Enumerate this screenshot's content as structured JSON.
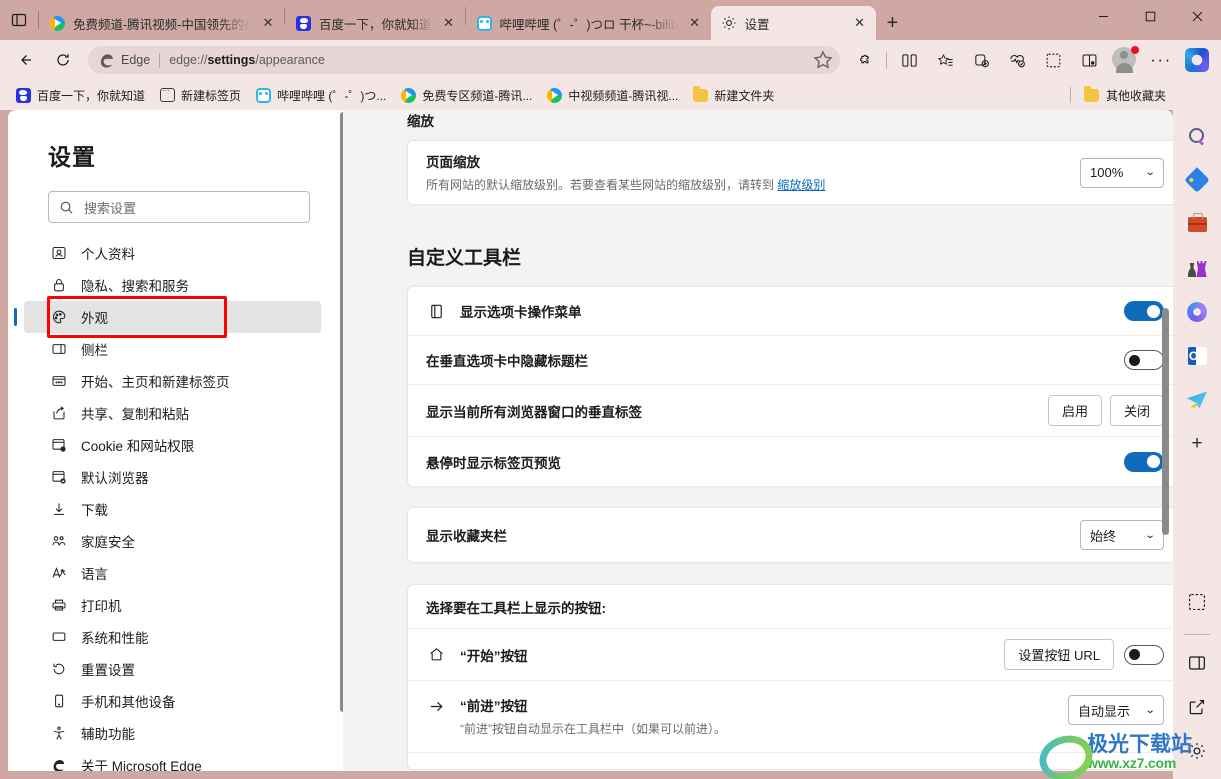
{
  "window": {
    "minimize_label": "最小化",
    "maximize_label": "最大化",
    "close_label": "关闭"
  },
  "tabstrip": {
    "tab_list_tooltip": "选项卡操作菜单",
    "new_tab_label": "+",
    "tabs": [
      {
        "title": "免费频道-腾讯视频-中国领先的在",
        "icon": "tencent-video-icon",
        "active": false,
        "close": "✕"
      },
      {
        "title": "百度一下，你就知道",
        "icon": "baidu-icon",
        "active": false,
        "close": "✕"
      },
      {
        "title": "哔哩哔哩 (゜-゜)つロ 干杯~-bilib",
        "icon": "bilibili-icon",
        "active": false,
        "close": "✕"
      },
      {
        "title": "设置",
        "icon": "gear-icon",
        "active": true,
        "close": "✕"
      }
    ]
  },
  "navbar": {
    "back_label": "后退",
    "refresh_label": "刷新",
    "omnibox": {
      "brand": "Edge",
      "url_prefix": "edge://",
      "url_bold": "settings",
      "url_suffix": "/appearance",
      "favorite_label": "添加到收藏夹"
    },
    "toolbar_icons": [
      "extensions-icon",
      "split-screen-icon",
      "favorites-icon",
      "collections-icon",
      "browser-essentials-icon",
      "screenshot-icon",
      "read-aloud-icon"
    ],
    "profile_label": "个人资料",
    "more_label": "设置及其他",
    "copilot_label": "Copilot"
  },
  "bookmarks": {
    "items": [
      {
        "label": "百度一下，你就知道",
        "icon": "baidu-icon"
      },
      {
        "label": "新建标签页",
        "icon": "newtab-icon"
      },
      {
        "label": "哔哩哔哩 (゜-゜)つ...",
        "icon": "bilibili-icon"
      },
      {
        "label": "免费专区频道-腾讯...",
        "icon": "tencent-video-icon"
      },
      {
        "label": "中视频频道-腾讯视...",
        "icon": "tencent-video-icon"
      },
      {
        "label": "新建文件夹",
        "icon": "folder-icon"
      }
    ],
    "other_favorites": {
      "label": "其他收藏夹",
      "icon": "folder-icon"
    }
  },
  "settings_nav": {
    "title": "设置",
    "search_placeholder": "搜索设置",
    "items": [
      {
        "label": "个人资料",
        "icon": "profile-icon",
        "selected": false
      },
      {
        "label": "隐私、搜索和服务",
        "icon": "lock-icon",
        "selected": false
      },
      {
        "label": "外观",
        "icon": "palette-icon",
        "selected": true
      },
      {
        "label": "侧栏",
        "icon": "sidebar-icon",
        "selected": false
      },
      {
        "label": "开始、主页和新建标签页",
        "icon": "home-tab-icon",
        "selected": false
      },
      {
        "label": "共享、复制和粘贴",
        "icon": "share-icon",
        "selected": false
      },
      {
        "label": "Cookie 和网站权限",
        "icon": "cookie-icon",
        "selected": false
      },
      {
        "label": "默认浏览器",
        "icon": "default-browser-icon",
        "selected": false
      },
      {
        "label": "下载",
        "icon": "download-icon",
        "selected": false
      },
      {
        "label": "家庭安全",
        "icon": "family-icon",
        "selected": false
      },
      {
        "label": "语言",
        "icon": "language-icon",
        "selected": false
      },
      {
        "label": "打印机",
        "icon": "printer-icon",
        "selected": false
      },
      {
        "label": "系统和性能",
        "icon": "system-icon",
        "selected": false
      },
      {
        "label": "重置设置",
        "icon": "reset-icon",
        "selected": false
      },
      {
        "label": "手机和其他设备",
        "icon": "phone-icon",
        "selected": false
      },
      {
        "label": "辅助功能",
        "icon": "accessibility-icon",
        "selected": false
      },
      {
        "label": "关于 Microsoft Edge",
        "icon": "edge-icon",
        "selected": false
      }
    ]
  },
  "main": {
    "zoom_section": {
      "heading": "缩放",
      "row_title": "页面缩放",
      "row_desc_prefix": "所有网站的默认缩放级别。若要查看某些网站的缩放级别，请转到 ",
      "row_desc_link": "缩放级别",
      "zoom_value": "100%",
      "chevron": "⌄"
    },
    "toolbar_section": {
      "heading": "自定义工具栏",
      "rows": [
        {
          "title": "显示选项卡操作菜单",
          "icon": "tab-actions-icon",
          "control": "toggle",
          "state": "on"
        },
        {
          "title": "在垂直选项卡中隐藏标题栏",
          "icon": null,
          "control": "toggle",
          "state": "off"
        },
        {
          "title": "显示当前所有浏览器窗口的垂直标签",
          "icon": null,
          "control": "buttons",
          "buttons": [
            "启用",
            "关闭"
          ]
        },
        {
          "title": "悬停时显示标签页预览",
          "icon": null,
          "control": "toggle",
          "state": "on"
        }
      ],
      "favorites_bar": {
        "title": "显示收藏夹栏",
        "value": "始终",
        "chevron": "⌄"
      },
      "buttons_card": {
        "heading": "选择要在工具栏上显示的按钮:",
        "rows": [
          {
            "title": "“开始”按钮",
            "icon": "home-icon",
            "desc": null,
            "button_label": "设置按钮 URL",
            "control": "toggle",
            "state": "off"
          },
          {
            "title": "“前进”按钮",
            "icon": "forward-arrow-icon",
            "desc": "“前进”按钮自动显示在工具栏中（如果可以前进）。",
            "select_value": "自动显示",
            "control": "select",
            "chevron": "⌄"
          }
        ]
      }
    }
  },
  "edge_sidebar": {
    "icons": [
      "search-icon",
      "shopping-tag-icon",
      "tools-icon",
      "games-icon",
      "m365-icon",
      "outlook-icon",
      "telegram-icon",
      "add-icon"
    ],
    "bottom_icons": [
      "screenshot-icon",
      "split-pane-icon",
      "open-external-icon",
      "sidebar-settings-icon"
    ]
  },
  "watermark": {
    "line1": "极光下载站",
    "line2": "www.xz7.com"
  },
  "colors": {
    "titlebar": "#cfa8a4",
    "toolbar": "#f4e6e5",
    "accent": "#0f6cbd",
    "page_bg": "#f3f3f3",
    "annotation": "#ff0000"
  }
}
